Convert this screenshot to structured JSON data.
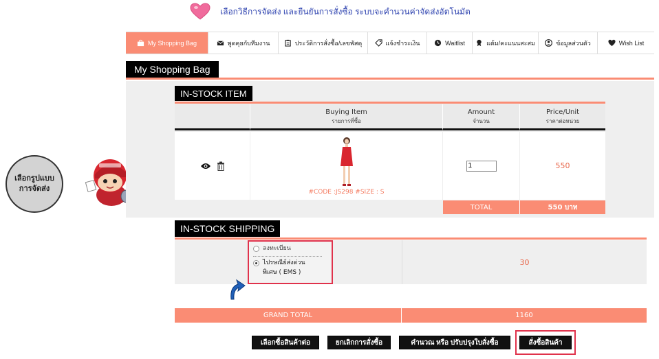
{
  "banner": {
    "text": "เลือกวิธีการจัดส่ง และยืนยันการสั่งซื้อ ระบบจะคำนวนค่าจัดส่งอัตโนมัต"
  },
  "bubble": {
    "line1": "เลือกรูปแบบ",
    "line2": "การจัดส่ง"
  },
  "nav": {
    "tabs": [
      {
        "label": "My Shopping Bag",
        "icon": "bag-icon"
      },
      {
        "label": "พูดคุยกับทีมงาน",
        "icon": "mail-icon"
      },
      {
        "label": "ประวัติการสั่งซื้อ/เลขพัสดุ",
        "icon": "clipboard-icon"
      },
      {
        "label": "แจ้งชำระเงิน",
        "icon": "tag-icon"
      },
      {
        "label": "Waitlist",
        "icon": "clock-icon"
      },
      {
        "label": "แต้ม/คะแนนสะสม",
        "icon": "award-icon"
      },
      {
        "label": "ข้อมูลส่วนตัว",
        "icon": "user-icon"
      },
      {
        "label": "Wish List",
        "icon": "heart-icon"
      }
    ]
  },
  "page_title": "My Shopping Bag",
  "instock": {
    "label": "IN-STOCK ITEM",
    "headers": {
      "item": "Buying Item",
      "item_sub": "รายการที่ซื้อ",
      "amount": "Amount",
      "amount_sub": "จำนวน",
      "price": "Price/Unit",
      "price_sub": "ราคาต่อหน่วย"
    },
    "item": {
      "code": "#CODE :JS298 #SIZE : S",
      "qty": "1",
      "price": "550"
    },
    "total_label": "TOTAL",
    "total_value": "550 บาท"
  },
  "shipping": {
    "label": "IN-STOCK SHIPPING",
    "option1": "ลงทะเบียน",
    "option2_line1": "ไปรษณีย์ส่งด่วน",
    "option2_line2": "พิเศษ ( EMS )",
    "price": "30"
  },
  "grand": {
    "label": "GRAND TOTAL",
    "value": "1160"
  },
  "buttons": {
    "continue": "เลือกซื้อสินค้าต่อ",
    "cancel": "ยกเลิกการสั่งซื้อ",
    "recalc": "คำนวณ หรือ ปรับปรุงใบสั่งซื้อ",
    "order": "สั่งซื้อสินค้า"
  },
  "colors": {
    "accent": "#fa8c74",
    "highlight": "#e0324b",
    "price": "#e8664a",
    "banner_text": "#2a3fae"
  }
}
